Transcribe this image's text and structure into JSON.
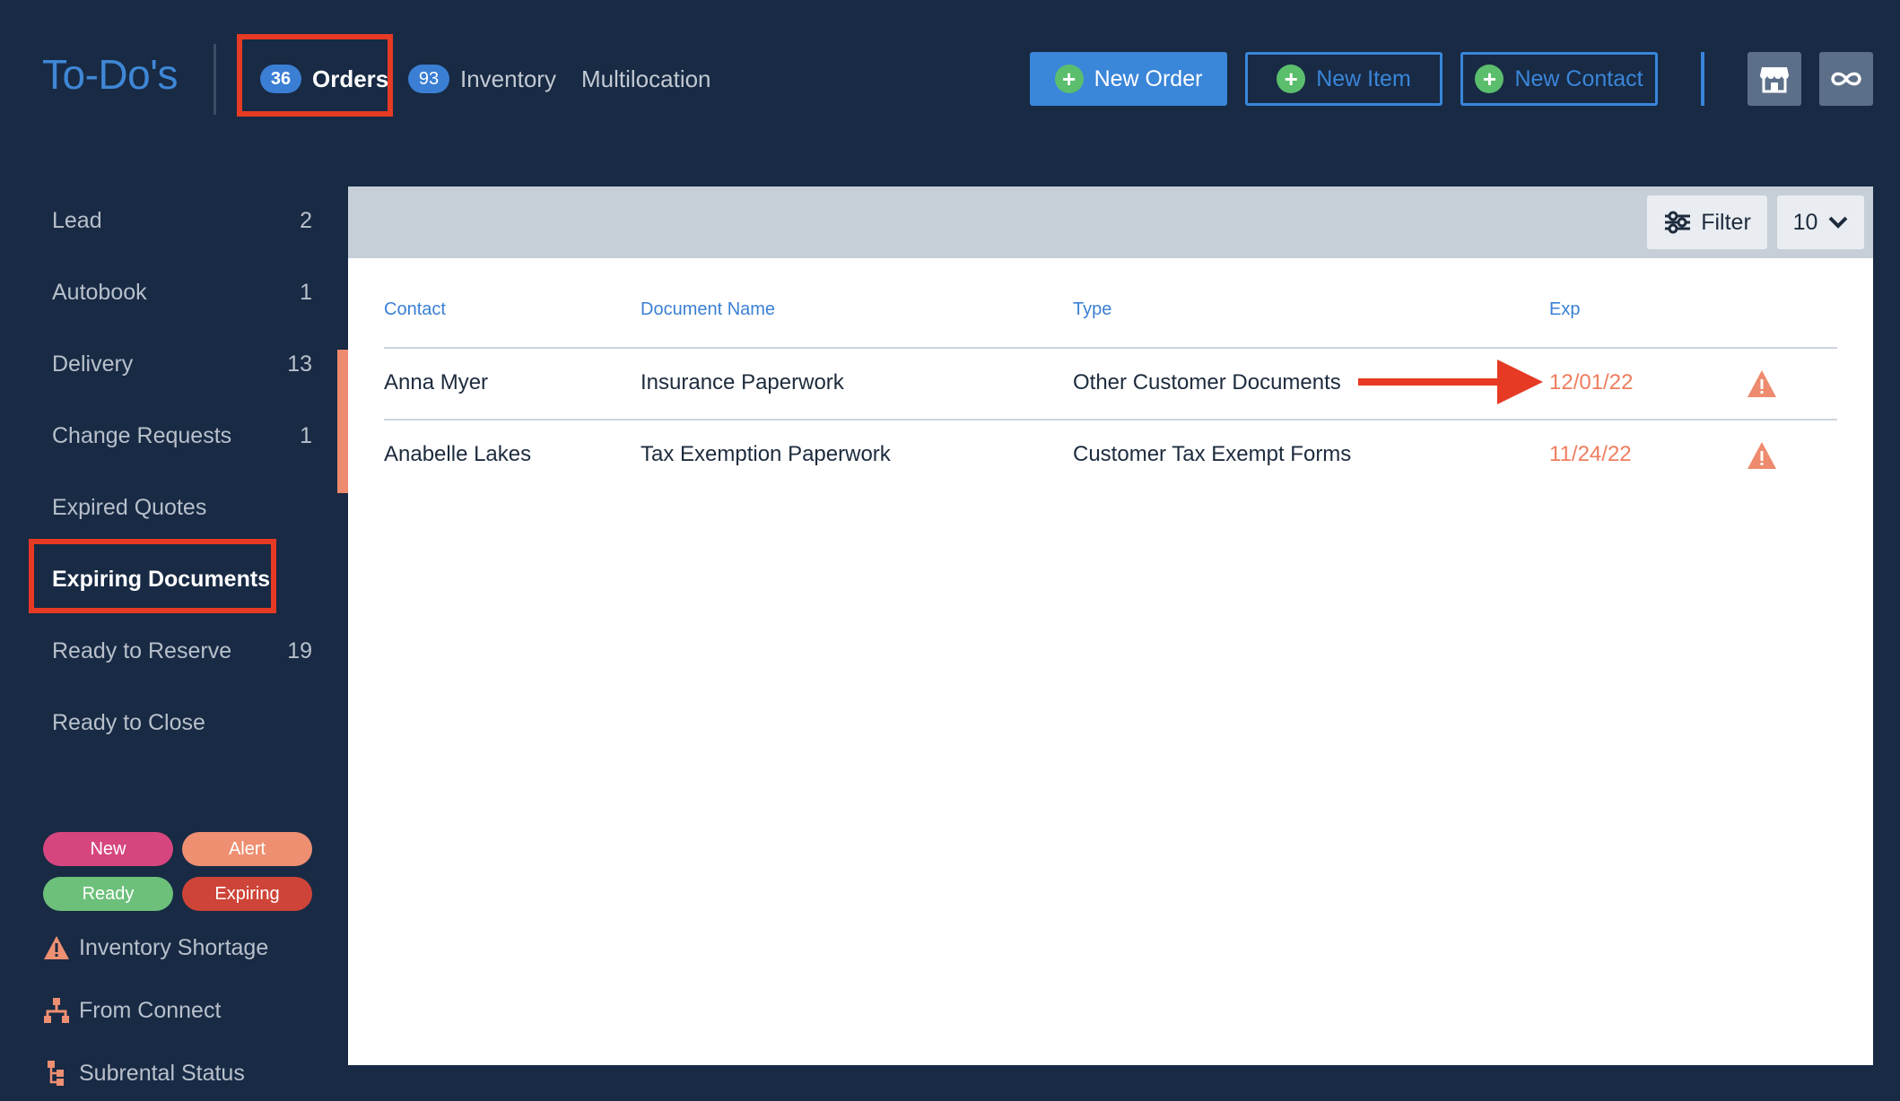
{
  "header": {
    "title": "To-Do's",
    "tabs": [
      {
        "badge": "36",
        "label": "Orders"
      },
      {
        "badge": "93",
        "label": "Inventory"
      },
      {
        "badge": "",
        "label": "Multilocation"
      }
    ],
    "buttons": {
      "new_order": "New Order",
      "new_item": "New Item",
      "new_contact": "New Contact"
    },
    "icons": [
      "store-icon",
      "infinity-link-icon"
    ]
  },
  "sidebar": {
    "items": [
      {
        "label": "Lead",
        "count": "2"
      },
      {
        "label": "Autobook",
        "count": "1"
      },
      {
        "label": "Delivery",
        "count": "13"
      },
      {
        "label": "Change Requests",
        "count": "1"
      },
      {
        "label": "Expired Quotes",
        "count": ""
      },
      {
        "label": "Expiring Documents",
        "count": ""
      },
      {
        "label": "Ready to Reserve",
        "count": "19"
      },
      {
        "label": "Ready to Close",
        "count": ""
      }
    ],
    "legend": {
      "pills": [
        {
          "label": "New",
          "color": "#d6457e"
        },
        {
          "label": "Alert",
          "color": "#ee8f72"
        },
        {
          "label": "Ready",
          "color": "#6cc07a"
        },
        {
          "label": "Expiring",
          "color": "#cf4438"
        }
      ],
      "rows": [
        {
          "label": "Inventory Shortage",
          "icon": "warning-icon"
        },
        {
          "label": "From Connect",
          "icon": "network-icon"
        },
        {
          "label": "Subrental Status",
          "icon": "subrental-icon"
        }
      ]
    }
  },
  "toolbar": {
    "filter_label": "Filter",
    "page_size": "10"
  },
  "table": {
    "columns": [
      "Contact",
      "Document Name",
      "Type",
      "Exp"
    ],
    "rows": [
      {
        "contact": "Anna Myer",
        "document": "Insurance Paperwork",
        "type": "Other Customer Documents",
        "exp": "12/01/22"
      },
      {
        "contact": "Anabelle Lakes",
        "document": "Tax Exemption Paperwork",
        "type": "Customer Tax Exempt Forms",
        "exp": "11/24/22"
      }
    ]
  },
  "colors": {
    "background": "#182a44",
    "accent_blue": "#3a86d9",
    "highlight_red": "#e63a25",
    "exp_orange": "#ef7d5f"
  }
}
